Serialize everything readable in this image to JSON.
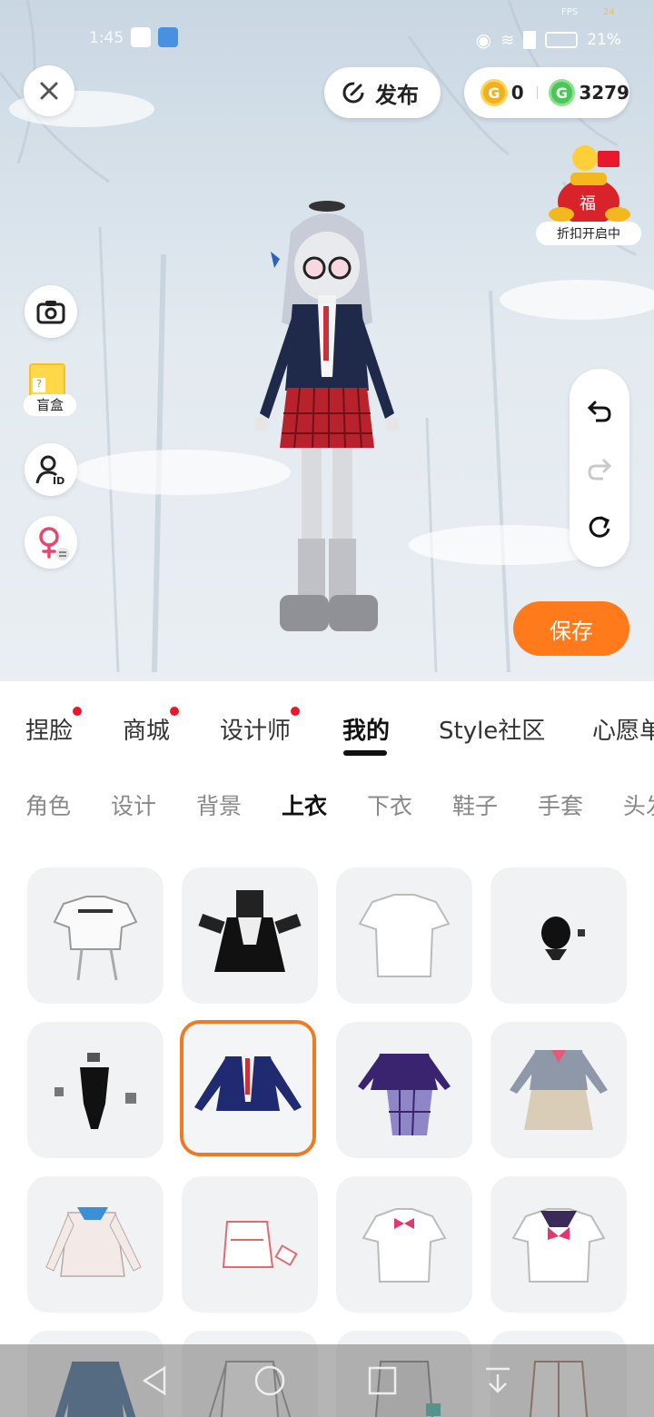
{
  "status_bar": {
    "time": "1:45",
    "battery": "21%",
    "fps_label": "FPS",
    "fps_value": "24"
  },
  "top": {
    "publish_label": "发布",
    "coins": {
      "gold": "0",
      "green": "3279"
    },
    "lucky_tag": "折扣开启中"
  },
  "left_tools": {
    "blind_box_label": "盲盒"
  },
  "save_label": "保存",
  "main_tabs": [
    {
      "label": "捏脸",
      "dot": true
    },
    {
      "label": "商城",
      "dot": true
    },
    {
      "label": "设计师",
      "dot": true
    },
    {
      "label": "我的",
      "dot": false,
      "active": true
    },
    {
      "label": "Style社区",
      "dot": false
    },
    {
      "label": "心愿单",
      "dot": false
    }
  ],
  "sub_tabs": [
    {
      "label": "角色"
    },
    {
      "label": "设计"
    },
    {
      "label": "背景"
    },
    {
      "label": "上衣",
      "active": true
    },
    {
      "label": "下衣"
    },
    {
      "label": "鞋子"
    },
    {
      "label": "手套"
    },
    {
      "label": "头发"
    }
  ],
  "items": [
    {
      "name": "white-graphic-tee"
    },
    {
      "name": "black-maid-dress"
    },
    {
      "name": "plain-white-tee"
    },
    {
      "name": "black-top-small"
    },
    {
      "name": "black-bodysuit"
    },
    {
      "name": "navy-blazer",
      "selected": true
    },
    {
      "name": "purple-plaid-uniform"
    },
    {
      "name": "grey-sailor-uniform"
    },
    {
      "name": "white-cardigan"
    },
    {
      "name": "pink-outline-top"
    },
    {
      "name": "white-shirt-bow"
    },
    {
      "name": "sailor-top"
    },
    {
      "name": "blue-jacket"
    },
    {
      "name": "outline-coat"
    },
    {
      "name": "grey-coat"
    },
    {
      "name": "brown-outline-coat"
    }
  ],
  "colors": {
    "accent": "#ff7a1a",
    "dot": "#e8192c",
    "selected_border": "#f07a22"
  }
}
